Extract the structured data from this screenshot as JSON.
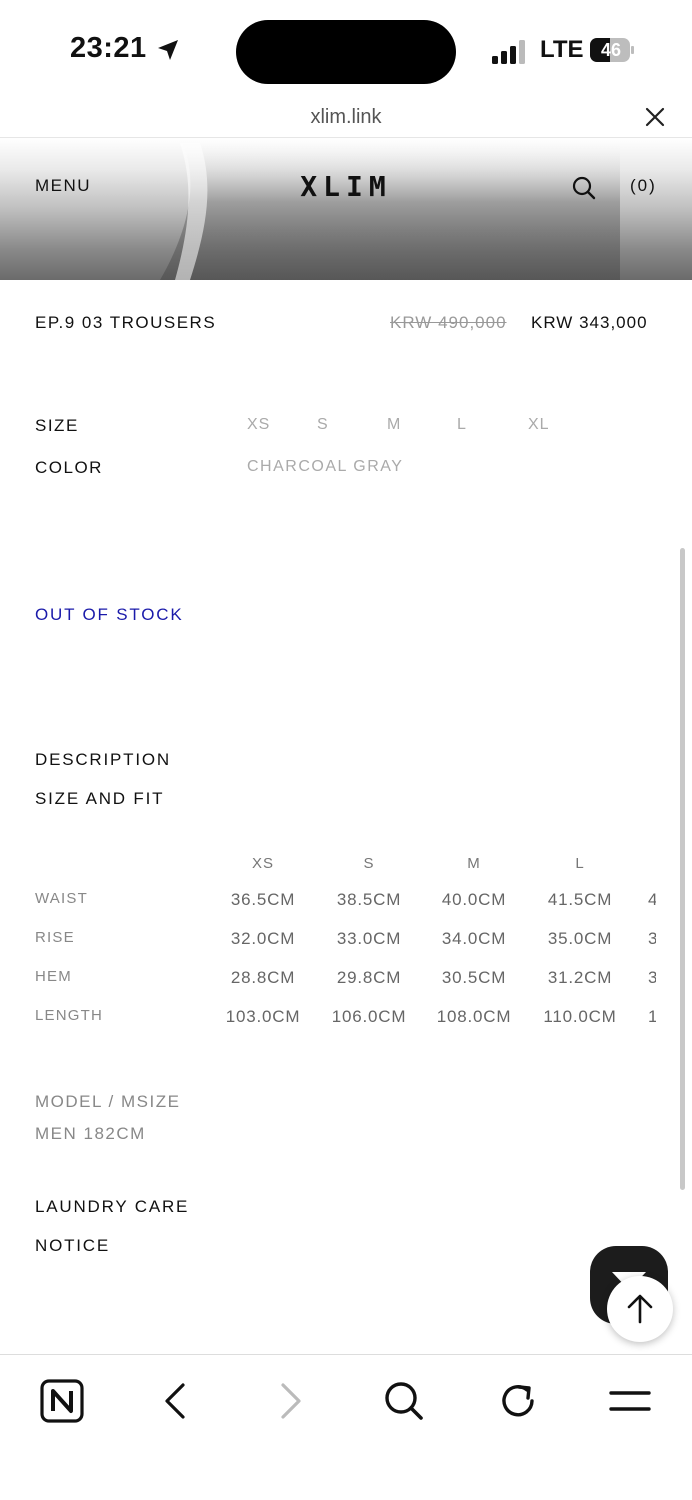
{
  "status_bar": {
    "time": "23:21",
    "carrier": "LTE",
    "battery": "46"
  },
  "browser": {
    "url": "xlim.link"
  },
  "header": {
    "menu_label": "MENU",
    "logo": "XLIM",
    "cart_label": "(0)"
  },
  "product": {
    "name": "EP.9 03 TROUSERS",
    "original_price": "KRW 490,000",
    "sale_price": "KRW 343,000",
    "size_label": "SIZE",
    "sizes": [
      "XS",
      "S",
      "M",
      "L",
      "XL"
    ],
    "color_label": "COLOR",
    "color_value": "CHARCOAL GRAY",
    "stock_status": "OUT OF STOCK"
  },
  "sections": {
    "description": "DESCRIPTION",
    "size_and_fit": "SIZE AND FIT",
    "laundry_care": "LAUNDRY CARE",
    "notice": "NOTICE"
  },
  "size_table": {
    "columns": [
      "XS",
      "S",
      "M",
      "L"
    ],
    "rows": [
      {
        "label": "WAIST",
        "values": [
          "36.5CM",
          "38.5CM",
          "40.0CM",
          "41.5CM"
        ],
        "clipped": "4"
      },
      {
        "label": "RISE",
        "values": [
          "32.0CM",
          "33.0CM",
          "34.0CM",
          "35.0CM"
        ],
        "clipped": "3"
      },
      {
        "label": "HEM",
        "values": [
          "28.8CM",
          "29.8CM",
          "30.5CM",
          "31.2CM"
        ],
        "clipped": "3"
      },
      {
        "label": "LENGTH",
        "values": [
          "103.0CM",
          "106.0CM",
          "108.0CM",
          "110.0CM"
        ],
        "clipped": "1"
      }
    ]
  },
  "model": {
    "line1": "MODEL / MSIZE",
    "line2": "MEN 182CM"
  },
  "icons": {
    "location": "location-arrow-icon",
    "signal": "signal-icon",
    "battery": "battery-icon",
    "close": "close-icon",
    "search": "search-icon",
    "scroll_top": "arrow-up-icon",
    "naver": "naver-home-icon",
    "back": "chevron-left-icon",
    "forward": "chevron-right-icon",
    "find": "search-icon",
    "reload": "reload-icon",
    "menu": "hamburger-menu-icon"
  },
  "colors": {
    "stock_status": "#1a1aaa",
    "muted": "#aaaaaa",
    "text": "#111111"
  }
}
